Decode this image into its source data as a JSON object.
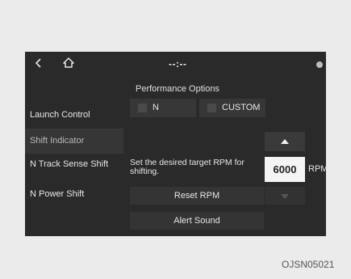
{
  "topbar": {
    "clock": "--:--",
    "icons": {
      "back": "back-arrow-icon",
      "home": "home-icon",
      "status": "status-icon"
    }
  },
  "page": {
    "title": "Performance Options"
  },
  "options": [
    {
      "label": "N"
    },
    {
      "label": "CUSTOM"
    }
  ],
  "sidebar": {
    "items": [
      {
        "label": "Launch Control"
      },
      {
        "label": "Shift Indicator"
      },
      {
        "label": "N Track Sense Shift"
      },
      {
        "label": "N Power Shift"
      }
    ]
  },
  "rpm": {
    "description": "Set the desired target RPM for shifting.",
    "value": "6000",
    "unit": "RPM"
  },
  "actions": {
    "reset": "Reset RPM",
    "alert": "Alert Sound"
  },
  "watermark": "OJSN05021",
  "colors": {
    "screen_bg": "#2a2a2a",
    "selected_item": "#363636",
    "button_bg": "#343434",
    "value_box": "#f4f4f4"
  }
}
